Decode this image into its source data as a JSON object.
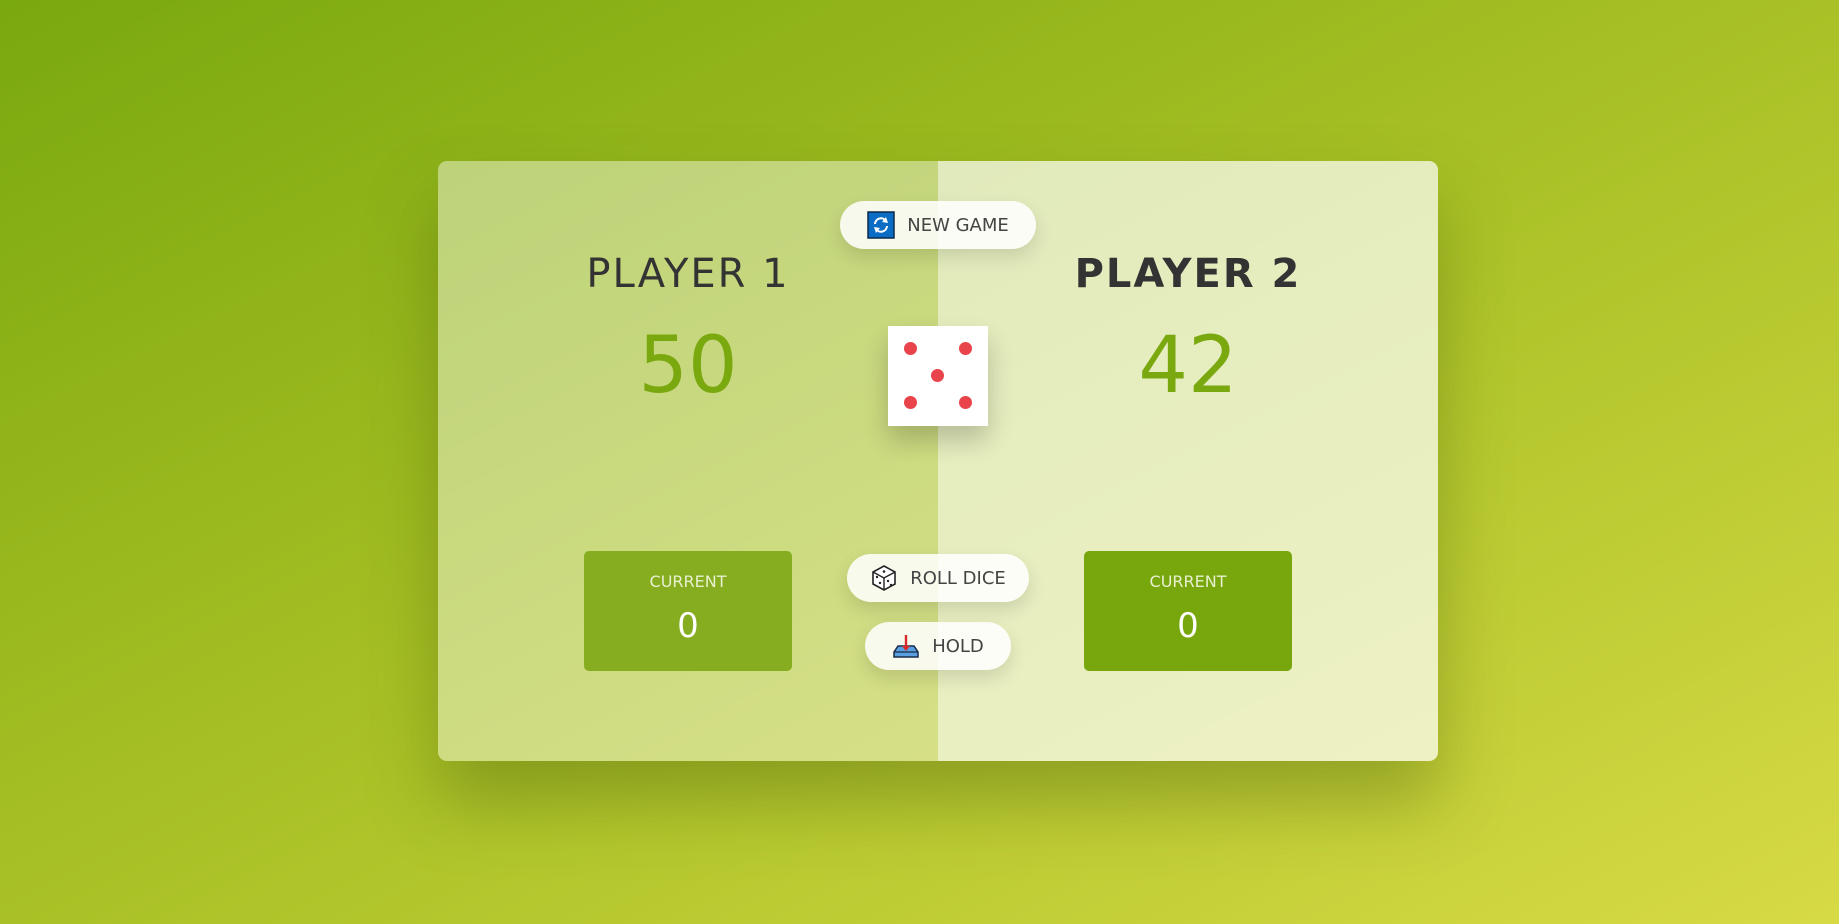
{
  "players": [
    {
      "name": "PLAYER 1",
      "score": "50",
      "current_label": "CURRENT",
      "current_score": "0",
      "active": false
    },
    {
      "name": "PLAYER 2",
      "score": "42",
      "current_label": "CURRENT",
      "current_score": "0",
      "active": true
    }
  ],
  "buttons": {
    "new_game": "NEW GAME",
    "roll_dice": "ROLL DICE",
    "hold": "HOLD"
  },
  "dice": {
    "value": 5
  },
  "colors": {
    "accent": "#7aa80f",
    "pip": "#e9434b",
    "new_game_icon": "#0a6cc4"
  },
  "icons": {
    "new_game": "refresh-icon",
    "roll_dice": "dice-icon",
    "hold": "hold-icon"
  }
}
